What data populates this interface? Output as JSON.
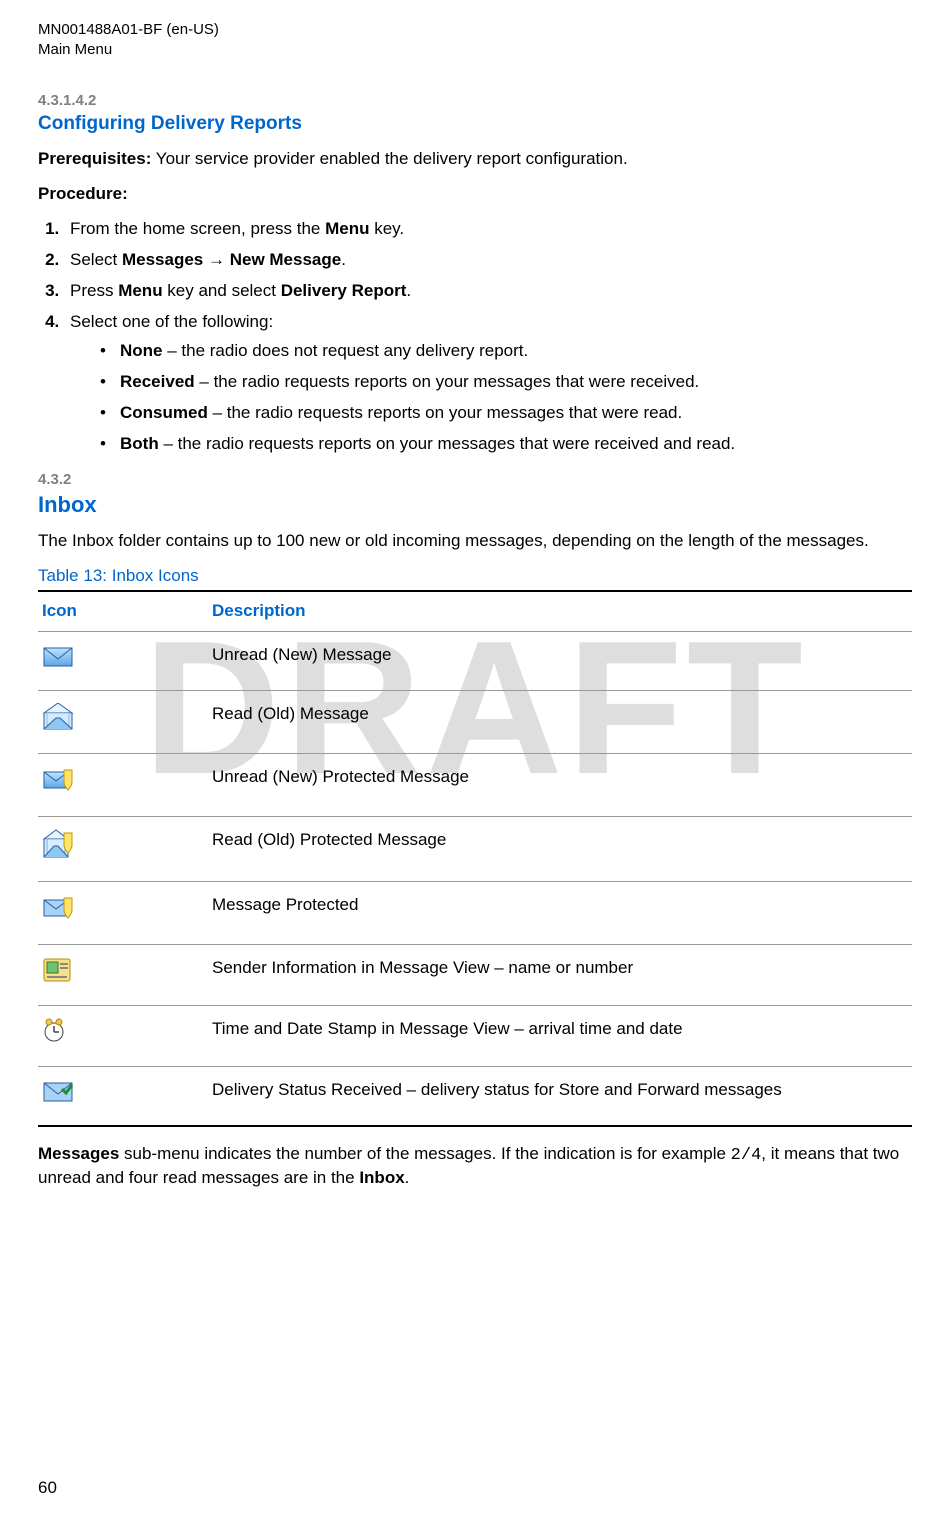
{
  "header": {
    "doc_id": "MN001488A01-BF (en-US)",
    "section": "Main Menu"
  },
  "watermark": "DRAFT",
  "section1": {
    "number": "4.3.1.4.2",
    "title": "Configuring Delivery Reports",
    "prereq_label": "Prerequisites:",
    "prereq_text": " Your service provider enabled the delivery report configuration.",
    "procedure_label": "Procedure:",
    "steps": {
      "s1a": "From the home screen, press the ",
      "s1b": "Menu",
      "s1c": " key.",
      "s2a": "Select ",
      "s2b": "Messages",
      "s2arrow": " → ",
      "s2c": "New Message",
      "s2d": ".",
      "s3a": "Press ",
      "s3b": "Menu",
      "s3c": " key and select ",
      "s3d": "Delivery Report",
      "s3e": ".",
      "s4": "Select one of the following:"
    },
    "options": {
      "o1b": "None",
      "o1t": " – the radio does not request any delivery report.",
      "o2b": "Received",
      "o2t": " – the radio requests reports on your messages that were received.",
      "o3b": "Consumed",
      "o3t": " – the radio requests reports on your messages that were read.",
      "o4b": "Both",
      "o4t": " – the radio requests reports on your messages that were received and read."
    }
  },
  "section2": {
    "number": "4.3.2",
    "title": "Inbox",
    "intro": "The Inbox folder contains up to 100 new or old incoming messages, depending on the length of the messages.",
    "table_caption": "Table 13: Inbox Icons",
    "headers": {
      "icon": "Icon",
      "desc": "Description"
    },
    "rows": [
      {
        "desc": "Unread (New) Message"
      },
      {
        "desc": "Read (Old) Message"
      },
      {
        "desc": "Unread (New) Protected Message"
      },
      {
        "desc": "Read (Old) Protected Message"
      },
      {
        "desc": "Message Protected"
      },
      {
        "desc": "Sender Information in Message View – name or number"
      },
      {
        "desc": "Time and Date Stamp in Message View – arrival time and date"
      },
      {
        "desc": "Delivery Status Received – delivery status for Store and Forward messages"
      }
    ],
    "footer": {
      "p1a": "Messages",
      "p1b": " sub-menu indicates the number of the messages. If the indication is for example ",
      "p1c": "2/4",
      "p1d": ", it means that two unread and four read messages are in the ",
      "p1e": "Inbox",
      "p1f": "."
    }
  },
  "page_number": "60"
}
